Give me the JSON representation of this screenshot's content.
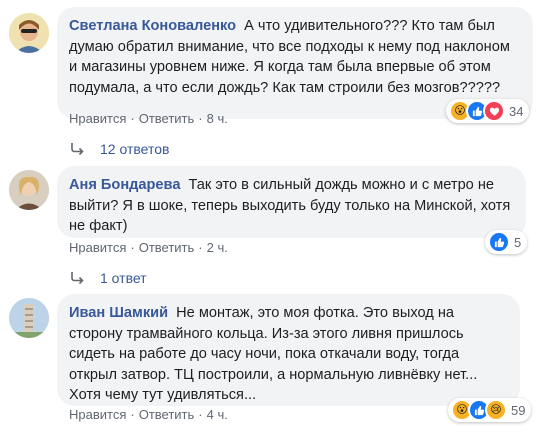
{
  "comments": [
    {
      "author": "Светлана Коноваленко",
      "text": "А что удивительного??? Кто там был думаю обратил внимание, что все подходы к нему под наклоном и магазины уровнем ниже. Я когда там была впервые об этом подумала, а что если дождь? Как там строили без мозгов?????",
      "like": "Нравится",
      "reply": "Ответить",
      "time": "8 ч.",
      "reaction_count": "34",
      "reactions": [
        "wow",
        "like",
        "love"
      ],
      "replies_label": "12 ответов"
    },
    {
      "author": "Аня Бондарева",
      "text": "Так это в сильный дождь можно и с метро не выйти? Я в шоке, теперь выходить буду только на Минской, хотя не факт)",
      "like": "Нравится",
      "reply": "Ответить",
      "time": "2 ч.",
      "reaction_count": "5",
      "reactions": [
        "like"
      ],
      "replies_label": "1 ответ"
    },
    {
      "author": "Иван Шамкий",
      "text": "Не монтаж, это моя фотка. Это выход на сторону трамвайного кольца. Из-за этого ливня пришлось сидеть на работе до часу ночи, пока откачали воду, тогда открыл затвор. ТЦ построили, а нормальную ливнёвку нет... Хотя чему тут удивляться...",
      "like": "Нравится",
      "reply": "Ответить",
      "time": "4 ч.",
      "reaction_count": "59",
      "reactions": [
        "wow",
        "like",
        "sad"
      ]
    }
  ],
  "separator": "·",
  "colors": {
    "bubble": "#f2f3f5",
    "author": "#385898",
    "meta": "#606770",
    "like": "#1877f2",
    "love": "#f33e58",
    "wow": "#f7b125"
  }
}
